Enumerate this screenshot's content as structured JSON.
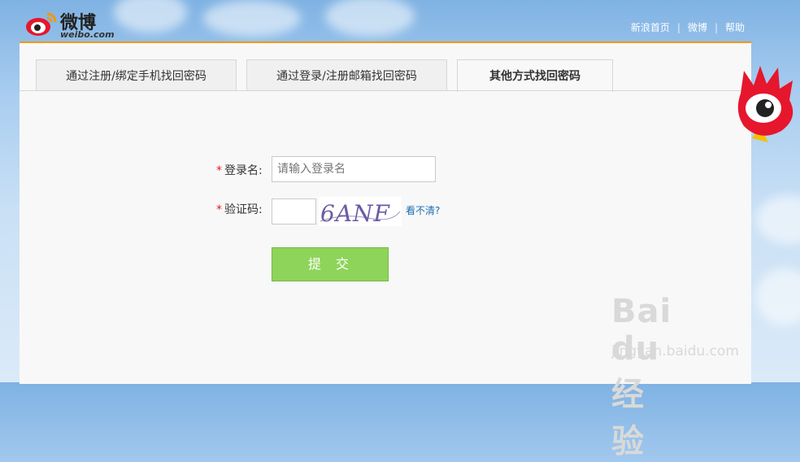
{
  "header": {
    "logo_text": "微博",
    "logo_sub": "weibo.com",
    "nav": [
      "新浪首页",
      "微博",
      "帮助"
    ]
  },
  "tabs": [
    {
      "label": "通过注册/绑定手机找回密码",
      "active": false
    },
    {
      "label": "通过登录/注册邮箱找回密码",
      "active": false
    },
    {
      "label": "其他方式找回密码",
      "active": true
    }
  ],
  "form": {
    "required_mark": "*",
    "login_name_label": "登录名:",
    "login_name_placeholder": "请输入登录名",
    "captcha_label": "验证码:",
    "captcha_image_text": "6ANF",
    "refresh_link": "看不清?",
    "submit_label": "提交"
  },
  "watermark": {
    "main": "Bai du 经验",
    "sub": "jingyan.baidu.com"
  },
  "colors": {
    "accent": "#f39800",
    "submit": "#8ed45a",
    "link": "#1a6db3",
    "required": "#e02020"
  }
}
